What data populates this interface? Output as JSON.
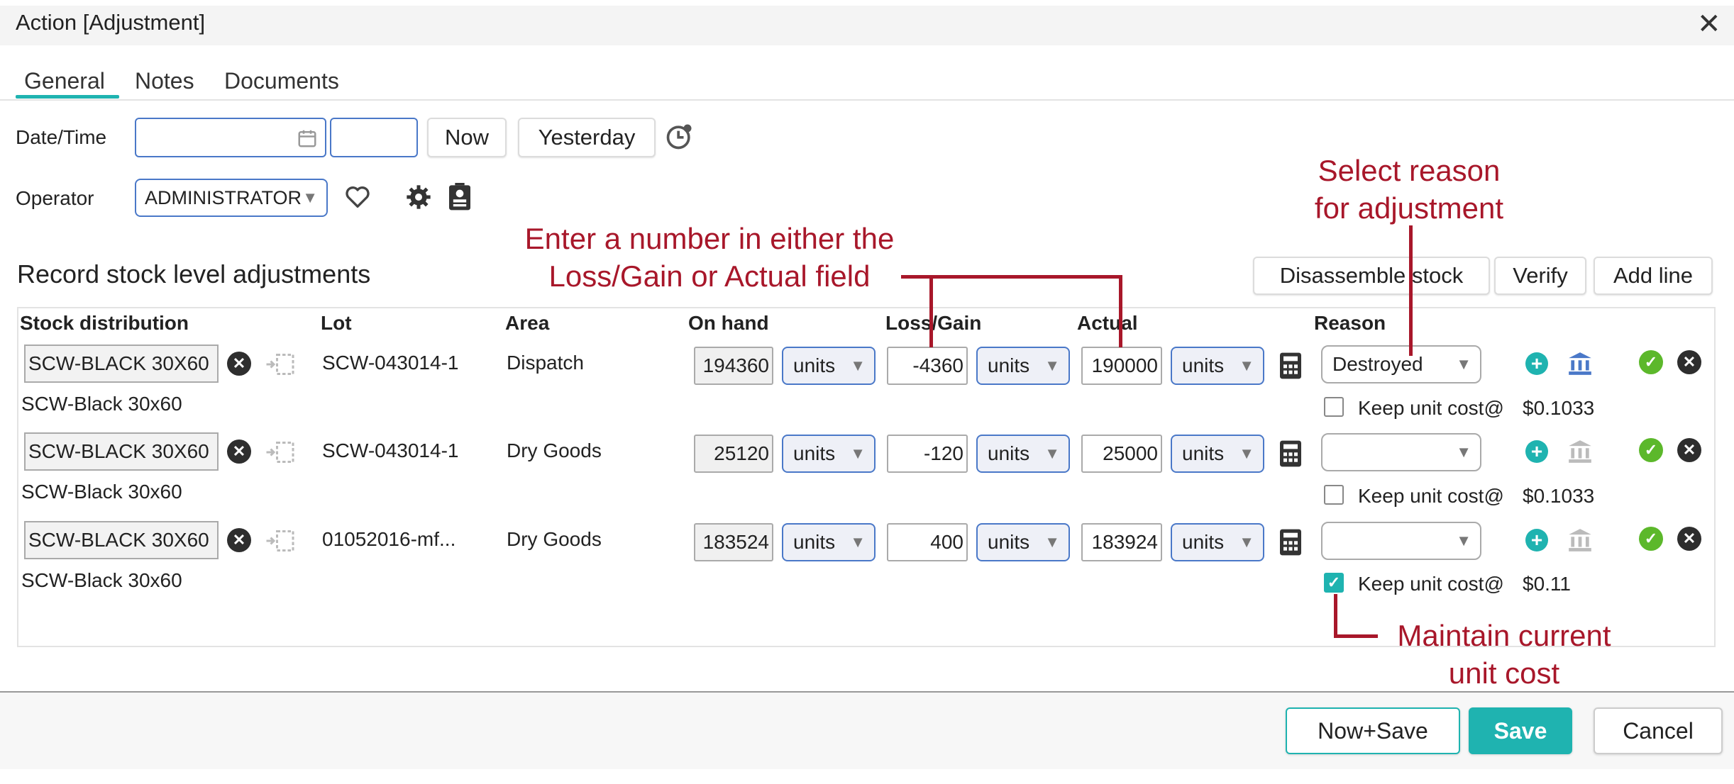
{
  "window": {
    "title": "Action [Adjustment]"
  },
  "tabs": [
    {
      "label": "General",
      "active": true
    },
    {
      "label": "Notes"
    },
    {
      "label": "Documents"
    }
  ],
  "form": {
    "datetime_label": "Date/Time",
    "date_value": "",
    "time_value": "",
    "now_label": "Now",
    "yesterday_label": "Yesterday",
    "operator_label": "Operator",
    "operator_value": "ADMINISTRATOR"
  },
  "section": {
    "title": "Record stock level adjustments",
    "disassemble_label": "Disassemble stock",
    "verify_label": "Verify",
    "add_line_label": "Add line"
  },
  "columns": {
    "stock": "Stock distribution",
    "lot": "Lot",
    "area": "Area",
    "onhand": "On hand",
    "lossgain": "Loss/Gain",
    "actual": "Actual",
    "reason": "Reason"
  },
  "rows": [
    {
      "code": "SCW-BLACK 30X60",
      "desc": "SCW-Black 30x60",
      "lot": "SCW-043014-1",
      "area": "Dispatch",
      "onhand": "194360",
      "onhand_units": "units",
      "lossgain": "-4360",
      "lossgain_units": "units",
      "actual": "190000",
      "actual_units": "units",
      "reason": "Destroyed",
      "keep_label": "Keep unit cost@",
      "cost": "$0.1033",
      "keep_checked": false
    },
    {
      "code": "SCW-BLACK 30X60",
      "desc": "SCW-Black 30x60",
      "lot": "SCW-043014-1",
      "area": "Dry Goods",
      "onhand": "25120",
      "onhand_units": "units",
      "lossgain": "-120",
      "lossgain_units": "units",
      "actual": "25000",
      "actual_units": "units",
      "reason": "",
      "keep_label": "Keep unit cost@",
      "cost": "$0.1033",
      "keep_checked": false
    },
    {
      "code": "SCW-BLACK 30X60",
      "desc": "SCW-Black 30x60",
      "lot": "01052016-mf...",
      "area": "Dry Goods",
      "onhand": "183524",
      "onhand_units": "units",
      "lossgain": "400",
      "lossgain_units": "units",
      "actual": "183924",
      "actual_units": "units",
      "reason": "",
      "keep_label": "Keep unit cost@",
      "cost": "$0.11",
      "keep_checked": true
    }
  ],
  "annotations": {
    "reason_line1": "Select reason",
    "reason_line2": "for adjustment",
    "enter_line1": "Enter a number in either the",
    "enter_line2": "Loss/Gain or Actual field",
    "maintain_line1": "Maintain current",
    "maintain_line2": "unit cost"
  },
  "footer": {
    "now_save_label": "Now+Save",
    "save_label": "Save",
    "cancel_label": "Cancel"
  },
  "colors": {
    "accent": "#1fb3b0",
    "annotation": "#a8172a",
    "ok": "#5cb82b",
    "input_border": "#4a78c8"
  }
}
